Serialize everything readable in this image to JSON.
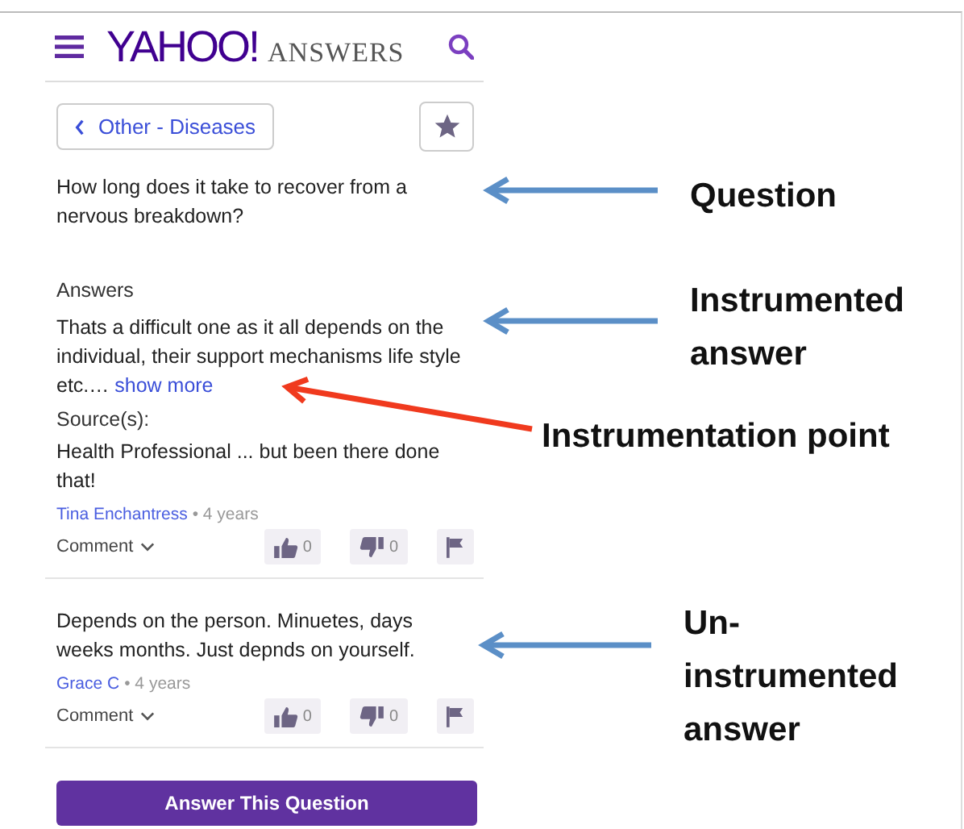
{
  "header": {
    "logo": "YAHOO!",
    "logo_suffix": "ANSWERS"
  },
  "breadcrumb": "Other - Diseases",
  "question": "How long does it take to recover from a nervous breakdown?",
  "answers_heading": "Answers",
  "answers": [
    {
      "kind": "full",
      "text": "Thats a difficult one as it all depends on the individual, their support mechanisms life style etc.…",
      "show_more": "show more",
      "sources_label": "Source(s):",
      "sources_text": "Health Professional ... but been there done that!",
      "author": "Tina Enchantress",
      "age": "• 4 years",
      "comment": "Comment",
      "upvotes": "0",
      "downvotes": "0"
    },
    {
      "kind": "short",
      "text": "Depends on the person. Minuetes, days weeks months. Just depnds on yourself.",
      "author": "Grace C",
      "age": "• 4 years",
      "comment": "Comment",
      "upvotes": "0",
      "downvotes": "0"
    }
  ],
  "answer_button": "Answer This Question",
  "annotations": [
    {
      "text": "Question",
      "color": "#5b8fc7"
    },
    {
      "text": "Instrumented answer",
      "color": "#5b8fc7"
    },
    {
      "text": "Instrumentation point",
      "color": "#f03a1e"
    },
    {
      "text": "Un-instrumented answer",
      "color": "#5b8fc7"
    }
  ]
}
